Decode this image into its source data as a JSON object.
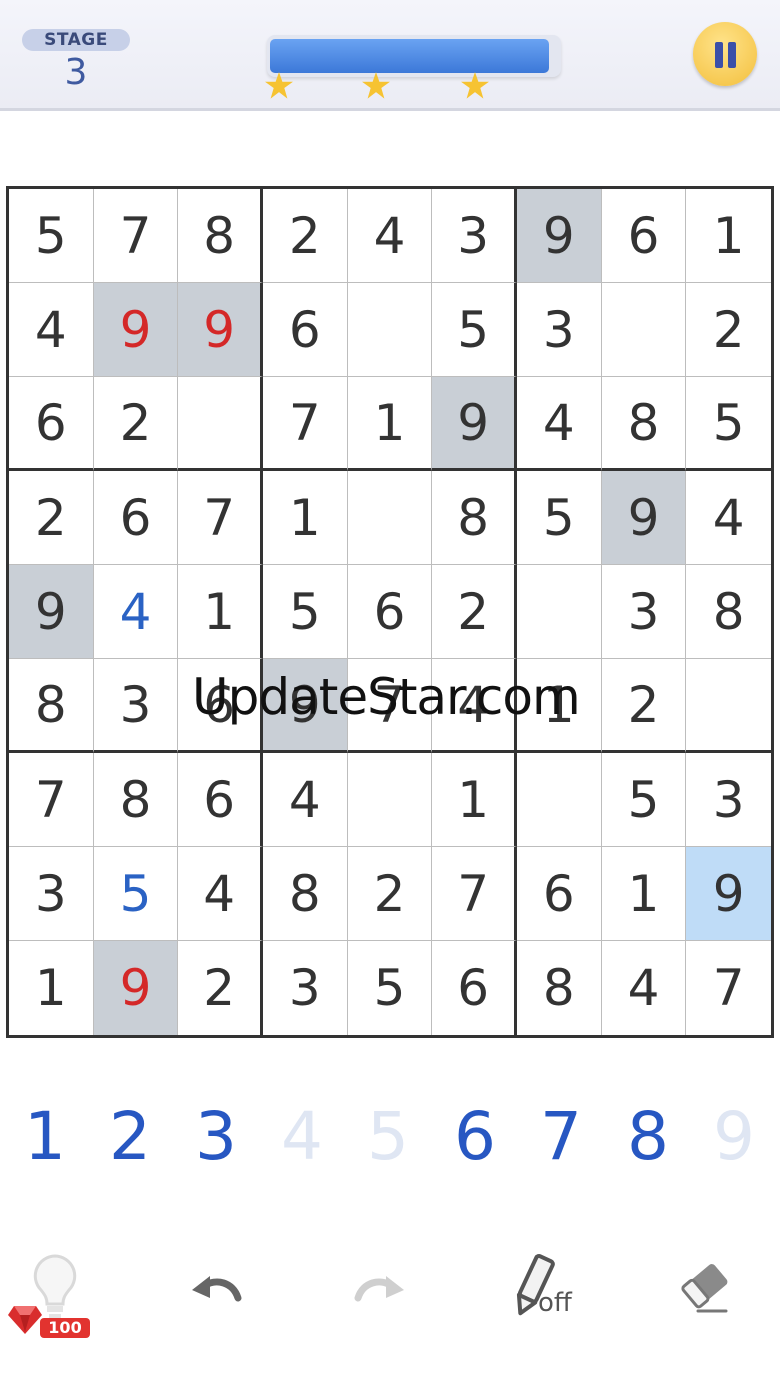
{
  "header": {
    "stage_label": "STAGE",
    "stage_number": "3",
    "progress": 0.97,
    "stars": 3,
    "pause_icon": "pause-icon"
  },
  "board": {
    "rows": [
      [
        "5",
        "7",
        "8",
        "2",
        "4",
        "3",
        "9",
        "6",
        "1"
      ],
      [
        "4",
        "9",
        "9",
        "6",
        "",
        "5",
        "3",
        "",
        "2"
      ],
      [
        "6",
        "2",
        "",
        "7",
        "1",
        "9",
        "4",
        "8",
        "5"
      ],
      [
        "2",
        "6",
        "7",
        "1",
        "",
        "8",
        "5",
        "9",
        "4"
      ],
      [
        "9",
        "4",
        "1",
        "5",
        "6",
        "2",
        "",
        "3",
        "8"
      ],
      [
        "8",
        "3",
        "6",
        "9",
        "7",
        "4",
        "1",
        "2",
        ""
      ],
      [
        "7",
        "8",
        "6",
        "4",
        "",
        "1",
        "",
        "5",
        "3"
      ],
      [
        "3",
        "5",
        "4",
        "8",
        "2",
        "7",
        "6",
        "1",
        "9"
      ],
      [
        "1",
        "9",
        "2",
        "3",
        "5",
        "6",
        "8",
        "4",
        "7"
      ]
    ],
    "highlighted_cells": [
      [
        0,
        6
      ],
      [
        1,
        1
      ],
      [
        1,
        2
      ],
      [
        2,
        5
      ],
      [
        3,
        7
      ],
      [
        4,
        0
      ],
      [
        5,
        3
      ],
      [
        8,
        1
      ]
    ],
    "selected_cell": [
      7,
      8
    ],
    "error_cells": [
      [
        1,
        1
      ],
      [
        1,
        2
      ],
      [
        8,
        1
      ]
    ],
    "user_cells": [
      [
        4,
        1
      ],
      [
        7,
        1
      ]
    ],
    "colors": {
      "highlight": "#c9cfd6",
      "selected": "#bfdcf7",
      "error": "#d42828",
      "user": "#2a62c4",
      "given": "#333333"
    }
  },
  "watermark": "UpdateStar.com",
  "numpad": {
    "keys": [
      "1",
      "2",
      "3",
      "4",
      "5",
      "6",
      "7",
      "8",
      "9"
    ],
    "disabled": [
      "4",
      "5",
      "9"
    ]
  },
  "toolbar": {
    "hint_icon": "lightbulb-icon",
    "hint_cost": "100",
    "gem_icon": "ruby-icon",
    "undo_icon": "undo-icon",
    "redo_icon": "redo-icon",
    "pencil_icon": "pencil-icon",
    "pencil_state": "off",
    "eraser_icon": "eraser-icon"
  }
}
